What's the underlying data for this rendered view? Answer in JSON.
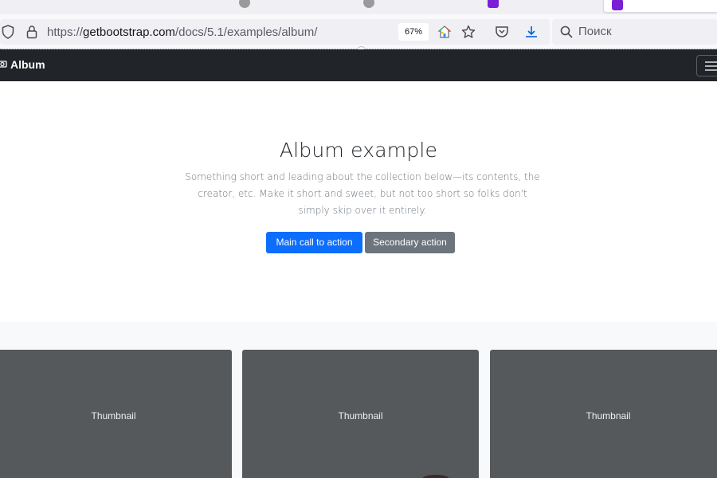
{
  "browser": {
    "url_prefix": "https://",
    "url_domain": "getbootstrap.com",
    "url_path": "/docs/5.1/examples/album/",
    "zoom": "67%",
    "search_placeholder": "Поиск",
    "icons": [
      "shield-icon",
      "lock-icon",
      "home-icon",
      "star-icon",
      "pocket-icon",
      "download-icon",
      "search-icon"
    ]
  },
  "navbar": {
    "brand": "Album"
  },
  "hero": {
    "title": "Album example",
    "lead": "Something short and leading about the collection below—its contents, the creator, etc. Make it short and sweet, but not too short so folks don't simply skip over it entirely.",
    "primary_button": "Main call to action",
    "secondary_button": "Secondary action"
  },
  "album": {
    "cards": [
      {
        "label": "Thumbnail"
      },
      {
        "label": "Thumbnail"
      },
      {
        "label": "Thumbnail"
      }
    ]
  },
  "colors": {
    "navbar_bg": "#212529",
    "primary": "#0d6efd",
    "secondary": "#6c757d",
    "thumbnail_bg": "#55595c"
  }
}
